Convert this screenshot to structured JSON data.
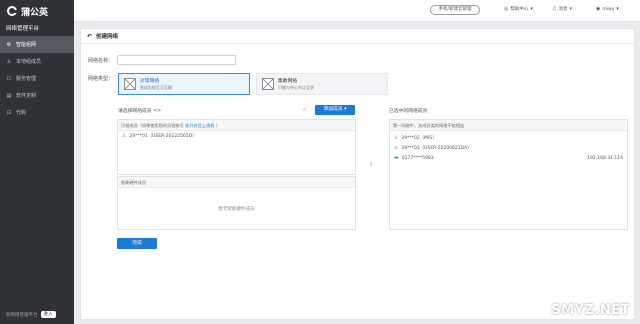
{
  "brand": {
    "name": "蒲公英",
    "platform": "网络管理平台"
  },
  "sidebar": {
    "items": [
      {
        "label": "智能组网",
        "icon": "network-icon",
        "active": true
      },
      {
        "label": "本地组成员",
        "icon": "user-icon",
        "active": false
      },
      {
        "label": "服务管理",
        "icon": "service-icon",
        "active": false
      },
      {
        "label": "软件定制",
        "icon": "software-icon",
        "active": false
      },
      {
        "label": "代购",
        "icon": "cart-icon",
        "active": false
      }
    ],
    "footer": {
      "label": "新网络管理平台",
      "enter": "进入"
    }
  },
  "topbar": {
    "pill": "手机/新建云管理",
    "help": "帮助中心",
    "messages": "消息",
    "user": "miwy"
  },
  "page": {
    "title": "创建网络",
    "network_name_label": "网络名称：",
    "network_name_value": "",
    "network_type_label": "网络类型：",
    "types": [
      {
        "title": "对等网络",
        "desc": "各成员相互可互联",
        "selected": true
      },
      {
        "title": "集散网络",
        "desc": "只能与中心节点互联",
        "selected": false
      }
    ],
    "choose_label": "请选择网络成员 <>",
    "add_button": "添加成员",
    "left_box": {
      "header": "贝锐成员（如果使用您的贝锐账号",
      "header_link": "先开启没上线权",
      "header_tail": "）",
      "members": [
        {
          "name": "29***01（USER-20122565D）"
        }
      ]
    },
    "smart_box": {
      "header": "智能硬件成员",
      "empty": "暂无智能硬件成员"
    },
    "right_title": "已选中的网络成员",
    "right_box": {
      "header": "第一网络中，务成员类的网络不能相连",
      "members": [
        {
          "name": "29***02（MIS）",
          "icon": "user-icon",
          "ip": ""
        },
        {
          "name": "29***03（USER-20200621DA）",
          "icon": "user-icon",
          "ip": ""
        },
        {
          "name": "0177****5983",
          "icon": "device-icon",
          "ip": "192.168.31.114"
        }
      ]
    },
    "done_button": "完成"
  },
  "watermark": "SMYZ.NET",
  "colors": {
    "accent": "#1d7bd8",
    "sidebar_bg": "#2f3237",
    "selected_bg": "#eaf4fd"
  }
}
